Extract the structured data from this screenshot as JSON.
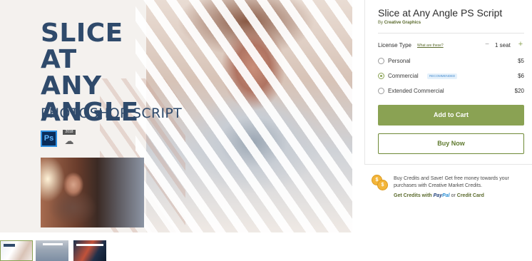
{
  "preview": {
    "title_lines": [
      "SLICE AT",
      "ANY",
      "ANGLE"
    ],
    "subtitle": "PHOTOSHOP SCRIPT",
    "ps_logo_text": "Ps",
    "cc_badge_text": "2018",
    "icons": [
      "photoshop-icon",
      "creative-cloud-icon"
    ]
  },
  "thumbnails": [
    "thumbnail-1",
    "thumbnail-2",
    "thumbnail-3"
  ],
  "product": {
    "title": "Slice at Any Angle PS Script",
    "by_prefix": "By",
    "author": "Creative Graphics"
  },
  "license": {
    "label": "License Type",
    "help_link": "What are these?",
    "quantity_minus": "−",
    "quantity": "1 seat",
    "quantity_plus": "+",
    "options": [
      {
        "label": "Personal",
        "price": "$5",
        "selected": false,
        "badge": ""
      },
      {
        "label": "Commercial",
        "price": "$6",
        "selected": true,
        "badge": "RECOMMENDED"
      },
      {
        "label": "Extended Commercial",
        "price": "$20",
        "selected": false,
        "badge": ""
      }
    ]
  },
  "buttons": {
    "add_to_cart": "Add to Cart",
    "buy_now": "Buy Now"
  },
  "credits": {
    "text": "Buy Credits and Save! Get free money towards your purchases with Creative Market Credits.",
    "link_prefix": "Get Credits with",
    "paypal_a": "Pay",
    "paypal_b": "Pal",
    "link_or": "or",
    "credit_card": "Credit Card"
  },
  "colors": {
    "accent": "#8aa253",
    "title_blue": "#2f4a6b",
    "badge_bg": "#e5f1fb",
    "badge_text": "#4a8fd1",
    "coin": "#f3b53a"
  }
}
